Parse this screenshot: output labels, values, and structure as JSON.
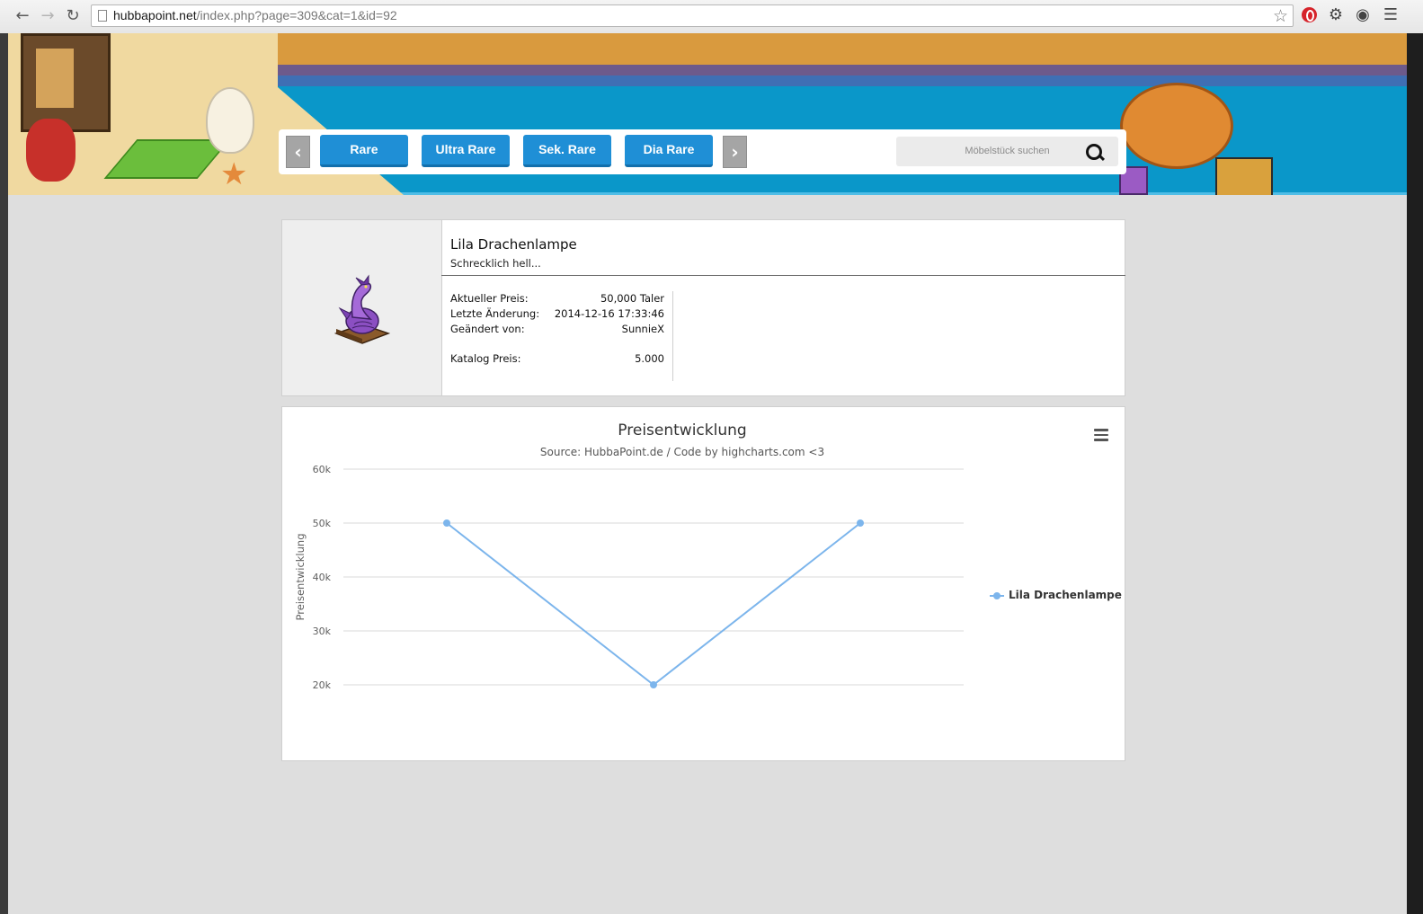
{
  "browser": {
    "url_host": "hubbapoint.net",
    "url_path": "/index.php?page=309&cat=1&id=92"
  },
  "nav": {
    "buttons": [
      "Rare",
      "Ultra Rare",
      "Sek. Rare",
      "Dia Rare"
    ],
    "search_placeholder": "Möbelstück suchen"
  },
  "item": {
    "name": "Lila Drachenlampe",
    "description": "Schrecklich hell...",
    "current_price_label": "Aktueller Preis:",
    "current_price": "50,000 Taler",
    "last_change_label": "Letzte Änderung:",
    "last_change": "2014-12-16 17:33:46",
    "changed_by_label": "Geändert von:",
    "changed_by": "SunnieX",
    "catalog_price_label": "Katalog Preis:",
    "catalog_price": "5.000"
  },
  "chart": {
    "title": "Preisentwicklung",
    "subtitle": "Source: HubbaPoint.de / Code by highcharts.com <3",
    "legend": "Lila Drachenlampe"
  },
  "chart_data": {
    "type": "line",
    "title": "Preisentwicklung",
    "subtitle": "Source: HubbaPoint.de / Code by highcharts.com <3",
    "xlabel": "",
    "ylabel": "Preisentwicklung",
    "ylim": [
      20000,
      60000
    ],
    "yticks": [
      20000,
      30000,
      40000,
      50000,
      60000
    ],
    "ytick_labels": [
      "20k",
      "30k",
      "40k",
      "50k",
      "60k"
    ],
    "grid": true,
    "legend_position": "right",
    "series": [
      {
        "name": "Lila Drachenlampe",
        "color": "#7cb5ec",
        "values": [
          50000,
          20000,
          50000
        ]
      }
    ]
  },
  "colors": {
    "accent": "#1f8fd6",
    "series": "#7cb5ec"
  }
}
